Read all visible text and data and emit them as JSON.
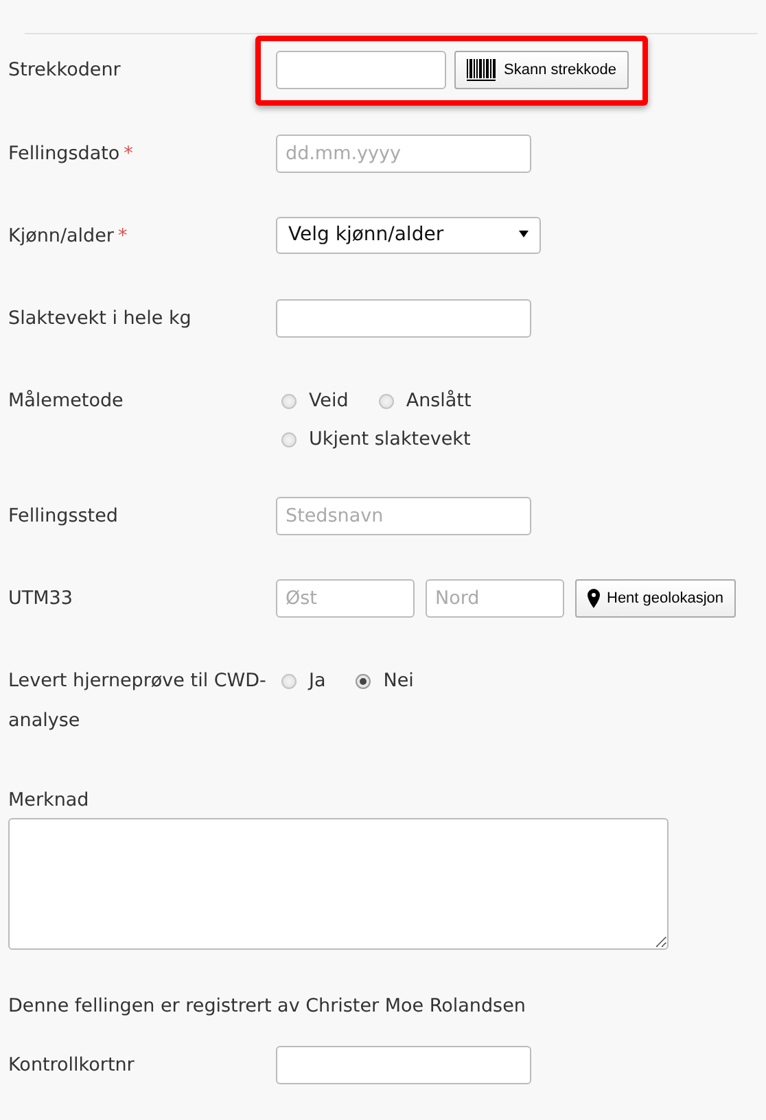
{
  "fields": [
    {
      "kind": "barcode",
      "label": "Strekkodenr",
      "highlighted": true,
      "button": "Skann strekkode"
    },
    {
      "kind": "text",
      "label": "Fellingsdato",
      "required_mark": "*",
      "placeholder": "dd.mm.yyyy"
    },
    {
      "kind": "select",
      "label": "Kjønn/alder",
      "required_mark": "*",
      "value": "Velg kjønn/alder"
    },
    {
      "kind": "text",
      "label": "Slaktevekt i hele kg"
    },
    {
      "kind": "radio",
      "label": "Målemetode",
      "options": [
        {
          "label": "Veid",
          "selected": false
        },
        {
          "label": "Anslått",
          "selected": false
        },
        {
          "label": "Ukjent slaktevekt",
          "selected": false
        }
      ]
    },
    {
      "kind": "text",
      "label": "Fellingssted",
      "placeholder": "Stedsnavn"
    },
    {
      "kind": "coords",
      "label": "UTM33",
      "inputs": [
        {
          "placeholder": "Øst"
        },
        {
          "placeholder": "Nord"
        }
      ],
      "button": "Hent geolokasjon"
    },
    {
      "kind": "radio",
      "label": "Levert hjerneprøve til CWD-analyse",
      "options": [
        {
          "label": "Ja",
          "selected": false
        },
        {
          "label": "Nei",
          "selected": true
        }
      ]
    },
    {
      "kind": "textarea",
      "label": "Merknad"
    },
    {
      "kind": "note",
      "label": "Denne fellingen er registrert av Christer Moe Rolandsen"
    },
    {
      "kind": "text",
      "label": "Kontrollkortnr"
    }
  ]
}
